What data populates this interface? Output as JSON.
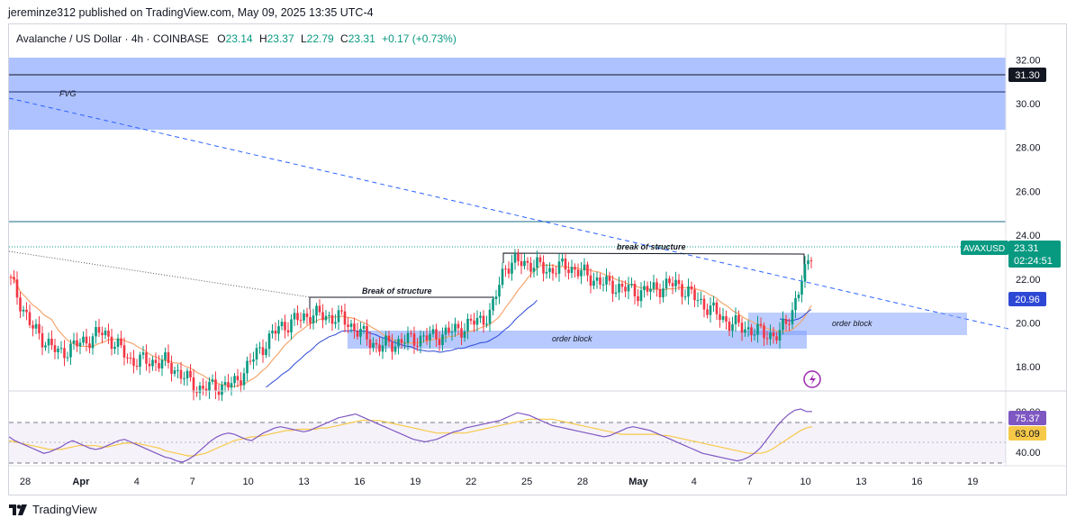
{
  "publisher_line": "jereminze312 published on TradingView.com, May 09, 2025 13:35 UTC-4",
  "symbol": {
    "name": "Avalanche / US Dollar · 4h · COINBASE",
    "o_label": "O",
    "o": "23.14",
    "h_label": "H",
    "h": "23.37",
    "l_label": "L",
    "l": "22.79",
    "c_label": "C",
    "c": "23.31",
    "change": "+0.17 (+0.73%)"
  },
  "price_axis": {
    "ticks": [
      "32.00",
      "30.00",
      "28.00",
      "26.00",
      "24.00",
      "22.00",
      "20.00",
      "18.00"
    ],
    "ymin": 16.9,
    "ymax": 33.0
  },
  "price_tags": {
    "level": "31.30",
    "ticker": "AVAXUSD",
    "last": "23.31",
    "countdown": "02:24:51",
    "ma": "20.96"
  },
  "rsi": {
    "tick_top": "80.00",
    "tick_bottom": "40.00",
    "rsi_value": "75.37",
    "ma_value": "63.09",
    "ymin": 30,
    "ymax": 82,
    "rsi": [
      55,
      52,
      50,
      48,
      46,
      44,
      42,
      43,
      45,
      47,
      50,
      52,
      50,
      48,
      46,
      45,
      46,
      48,
      50,
      52,
      53,
      51,
      49,
      47,
      45,
      43,
      41,
      39,
      38,
      36,
      35,
      37,
      40,
      44,
      48,
      52,
      55,
      57,
      58,
      57,
      55,
      53,
      52,
      55,
      58,
      60,
      62,
      63,
      62,
      61,
      60,
      59,
      60,
      62,
      64,
      66,
      68,
      70,
      71,
      72,
      73,
      71,
      69,
      67,
      65,
      63,
      61,
      59,
      57,
      55,
      53,
      52,
      51,
      52,
      53,
      55,
      57,
      59,
      60,
      62,
      63,
      64,
      65,
      66,
      67,
      68,
      70,
      72,
      74,
      73,
      72,
      70,
      68,
      66,
      64,
      63,
      62,
      61,
      60,
      59,
      58,
      57,
      56,
      55,
      56,
      58,
      60,
      62,
      63,
      62,
      61,
      60,
      58,
      56,
      54,
      52,
      50,
      48,
      46,
      44,
      42,
      41,
      40,
      39,
      38,
      37,
      36,
      37,
      39,
      42,
      46,
      52,
      58,
      64,
      69,
      73,
      76,
      77,
      75,
      75
    ],
    "ma": [
      52,
      51,
      50,
      49,
      48,
      47,
      46,
      45,
      45,
      45,
      46,
      47,
      48,
      48,
      48,
      48,
      47,
      47,
      48,
      49,
      50,
      50,
      50,
      49,
      48,
      47,
      46,
      44,
      43,
      42,
      41,
      40,
      40,
      41,
      42,
      44,
      46,
      48,
      50,
      52,
      53,
      54,
      55,
      55,
      56,
      57,
      58,
      59,
      60,
      60,
      61,
      61,
      61,
      61,
      62,
      62,
      63,
      64,
      65,
      66,
      67,
      68,
      68,
      68,
      68,
      67,
      66,
      65,
      64,
      63,
      62,
      61,
      60,
      59,
      58,
      58,
      58,
      58,
      58,
      58,
      59,
      60,
      61,
      62,
      63,
      64,
      65,
      66,
      67,
      68,
      69,
      69,
      69,
      69,
      69,
      68,
      67,
      66,
      65,
      64,
      63,
      62,
      61,
      60,
      59,
      58,
      57,
      57,
      57,
      57,
      57,
      57,
      57,
      56,
      56,
      55,
      54,
      53,
      52,
      51,
      50,
      49,
      48,
      47,
      46,
      45,
      44,
      43,
      42,
      42,
      42,
      43,
      45,
      48,
      51,
      54,
      57,
      60,
      62,
      63
    ]
  },
  "time_axis": [
    "28",
    "Apr",
    "4",
    "7",
    "10",
    "13",
    "16",
    "19",
    "22",
    "25",
    "28",
    "May",
    "4",
    "7",
    "10",
    "13",
    "16",
    "19"
  ],
  "annotations": {
    "fvg": "FVG",
    "bos_left": "Break of structure",
    "bos_right": "break of structure",
    "ob_left": "order block",
    "ob_right": "order block"
  },
  "chart_data": {
    "type": "line",
    "title": "Avalanche / US Dollar · 4h · COINBASE",
    "xlabel": "",
    "ylabel": "",
    "ylim": [
      16.9,
      33.0
    ],
    "x": [
      "28",
      "Apr",
      "4",
      "7",
      "10",
      "13",
      "16",
      "19",
      "22",
      "25",
      "28",
      "May",
      "4",
      "7",
      "10"
    ],
    "series": [
      {
        "name": "",
        "values": [
          22.1,
          19.8,
          18.6,
          17.2,
          18.2,
          20.4,
          19.1,
          19.4,
          22.8,
          22.5,
          21.7,
          21.8,
          20.1,
          19.6,
          23.31
        ]
      }
    ],
    "levels": [
      31.3,
      30.55,
      24.45,
      23.31
    ],
    "zones": [
      {
        "label": "FVG",
        "low": 28.75,
        "high": 32.15
      },
      {
        "label": "order block",
        "low": 18.7,
        "high": 19.55
      },
      {
        "label": "order block",
        "low": 19.35,
        "high": 20.35
      }
    ],
    "colors": {
      "up": "#089981",
      "down": "#f23645",
      "ma": "#f5a66e",
      "ma2": "#2e48d6",
      "zone": "#6d8cf7",
      "rsi": "#7e57c2",
      "rsi_ma": "#f7c948"
    }
  }
}
